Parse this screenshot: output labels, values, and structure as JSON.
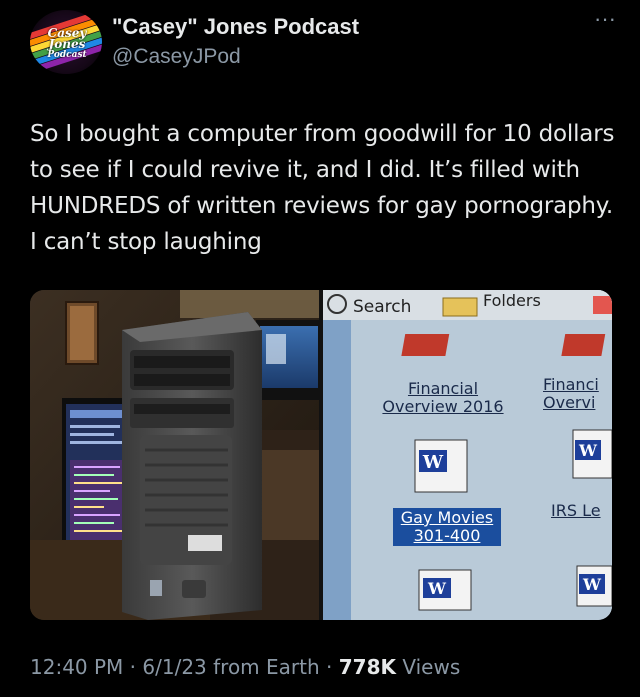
{
  "author": {
    "display_name": "\"Casey\" Jones Podcast",
    "handle": "@CaseyJPod",
    "avatar_logo_text": [
      "Casey",
      "Jones",
      "Podcast"
    ]
  },
  "more_label": "···",
  "tweet": {
    "text": "So I bought a computer from goodwill for 10 dollars to see if I could revive it, and I did. It’s filled with HUNDREDS of written reviews for gay pornography. I can’t stop laughing"
  },
  "photo_right": {
    "toolbar": {
      "search_label": "Search",
      "folders_label": "Folders"
    },
    "files": [
      {
        "label_line1": "Financial",
        "label_line2": "Overview 2016"
      },
      {
        "label_line1": "Financi",
        "label_line2": "Overvi"
      },
      {
        "label_line1": "Gay Movies",
        "label_line2": "301-400"
      },
      {
        "label_line1": "IRS Le",
        "label_line2": ""
      }
    ]
  },
  "meta": {
    "time": "12:40 PM",
    "date": "6/1/23",
    "source": "from Earth",
    "separator": "·",
    "views_count": "778K",
    "views_label": "Views"
  },
  "colors": {
    "background": "#000000",
    "text_primary": "#e7e9ea",
    "text_secondary": "#8b98a5",
    "selection": "#1b4e9e"
  }
}
